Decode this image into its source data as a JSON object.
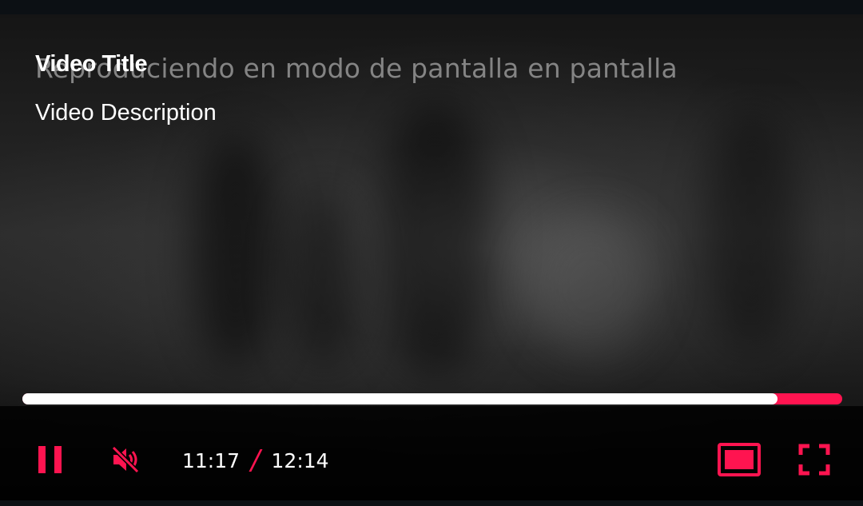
{
  "overlay": {
    "pip_notice": "Reproduciendo en modo de pantalla en pantalla",
    "title": "Video Title",
    "description": "Video Description"
  },
  "playback": {
    "current_time": "11:17",
    "separator": "/",
    "total_time": "12:14",
    "progress_fraction": 0.921
  },
  "controls": {
    "pause_icon": "pause-icon",
    "mute_icon": "volume-off-icon",
    "pip_icon": "picture-in-picture-icon",
    "fullscreen_icon": "fullscreen-icon"
  },
  "colors": {
    "accent": "#ff1450",
    "progress_played": "#ffffff",
    "text": "#ffffff"
  }
}
